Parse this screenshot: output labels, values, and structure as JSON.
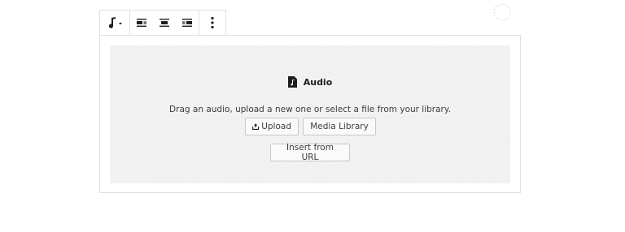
{
  "toolbar": {
    "items": [
      {
        "icon": "music-note-icon",
        "tooltip": "Change block type"
      },
      {
        "icon": "align-left-icon"
      },
      {
        "icon": "align-center-icon"
      },
      {
        "icon": "align-right-icon"
      },
      {
        "icon": "more-options-icon"
      }
    ]
  },
  "placeholder": {
    "icon": "audio-file-icon",
    "title": "Audio",
    "instructions": "Drag an audio, upload a new one or select a file from your library.",
    "buttons": {
      "upload": "Upload",
      "media_library": "Media Library",
      "insert_url": "Insert from URL"
    }
  },
  "colors": {
    "border": "#e0e0e0",
    "placeholder_bg": "#f0f0f0",
    "text": "#1e1e1e",
    "button_border": "#c8c8c8"
  }
}
